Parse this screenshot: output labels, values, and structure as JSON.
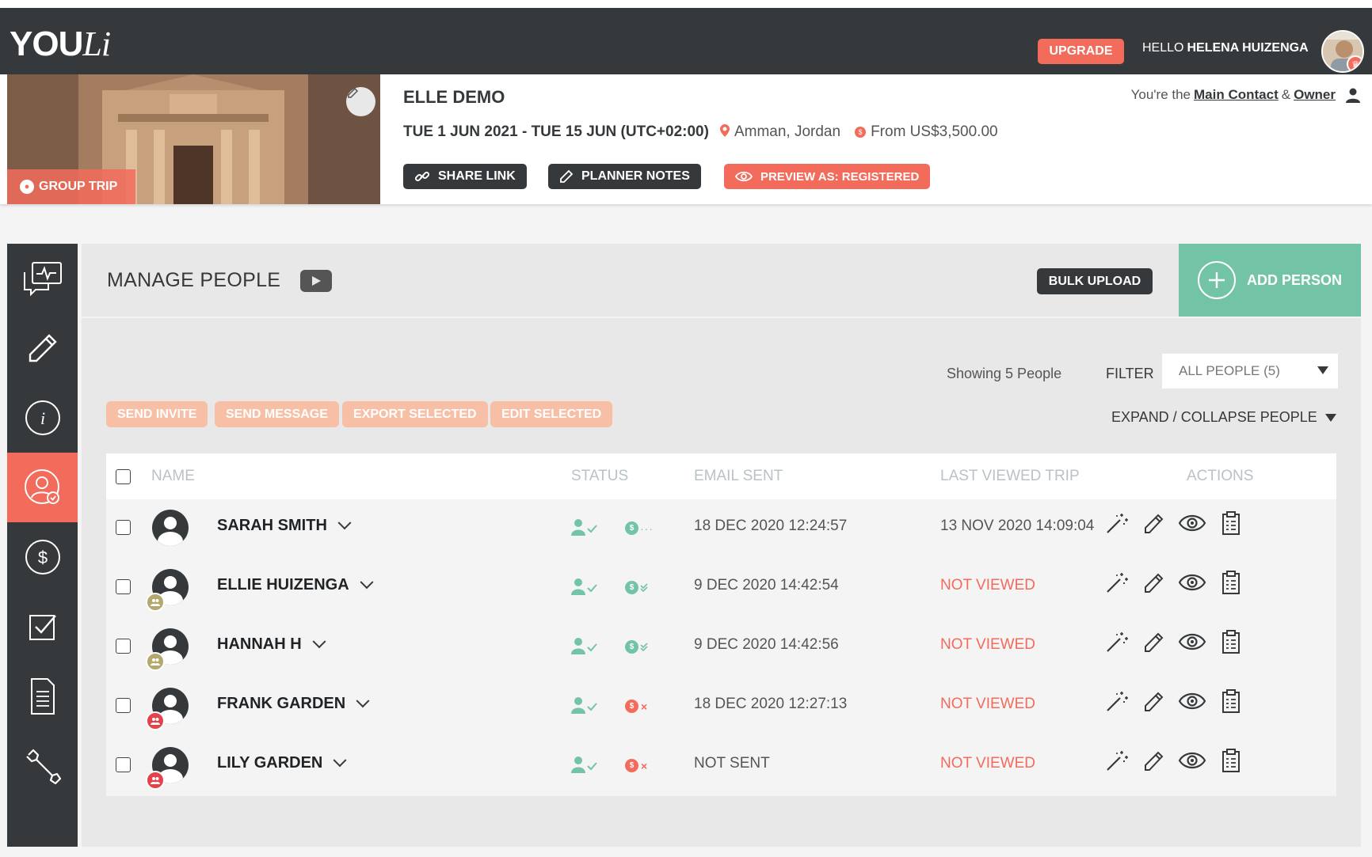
{
  "app": {
    "logo_main": "YOU",
    "logo_li": "Li"
  },
  "topbar": {
    "upgrade_label": "UPGRADE",
    "hello_label": "HELLO",
    "user_name": "HELENA HUIZENGA"
  },
  "trip": {
    "badge": "GROUP TRIP",
    "title": "ELLE DEMO",
    "dates": "TUE 1 JUN 2021 - TUE 15 JUN (UTC+02:00)",
    "location": "Amman, Jordan",
    "price": "From US$3,500.00",
    "role_prefix": "You're the",
    "role_main": "Main Contact",
    "role_amp": "&",
    "role_owner": "Owner",
    "share_label": "SHARE LINK",
    "planner_label": "PLANNER NOTES",
    "preview_label": "PREVIEW AS: REGISTERED"
  },
  "manage": {
    "title": "MANAGE PEOPLE",
    "bulk_label": "BULK UPLOAD",
    "add_label": "ADD PERSON",
    "showing": "Showing 5 People",
    "filter_label": "FILTER",
    "filter_value": "ALL PEOPLE (5)",
    "expand_label": "EXPAND / COLLAPSE PEOPLE",
    "actions": [
      "SEND INVITE",
      "SEND MESSAGE",
      "EXPORT SELECTED",
      "EDIT SELECTED"
    ],
    "columns": {
      "name": "NAME",
      "status": "STATUS",
      "email": "EMAIL SENT",
      "viewed": "LAST VIEWED TRIP",
      "actions": "ACTIONS"
    },
    "rows": [
      {
        "name": "SARAH SMITH",
        "email": "18 DEC 2020 12:24:57",
        "viewed": "13 NOV 2020 14:09:04",
        "viewed_status": "viewed",
        "pay": "pending",
        "badge": "none"
      },
      {
        "name": "ELLIE HUIZENGA",
        "email": "9 DEC 2020 14:42:54",
        "viewed": "NOT VIEWED",
        "viewed_status": "not",
        "pay": "paid",
        "badge": "olive"
      },
      {
        "name": "HANNAH H",
        "email": "9 DEC 2020 14:42:56",
        "viewed": "NOT VIEWED",
        "viewed_status": "not",
        "pay": "paid",
        "badge": "olive"
      },
      {
        "name": "FRANK GARDEN",
        "email": "18 DEC 2020 12:27:13",
        "viewed": "NOT VIEWED",
        "viewed_status": "not",
        "pay": "unpaid",
        "badge": "red"
      },
      {
        "name": "LILY GARDEN",
        "email": "NOT SENT",
        "viewed": "NOT VIEWED",
        "viewed_status": "not",
        "pay": "unpaid",
        "badge": "red"
      }
    ]
  },
  "colors": {
    "coral": "#f26b5b",
    "dark": "#36393b",
    "teal": "#73c4a7",
    "peach": "#f7c0a6",
    "olive": "#b5a86e",
    "red": "#e4414b"
  }
}
